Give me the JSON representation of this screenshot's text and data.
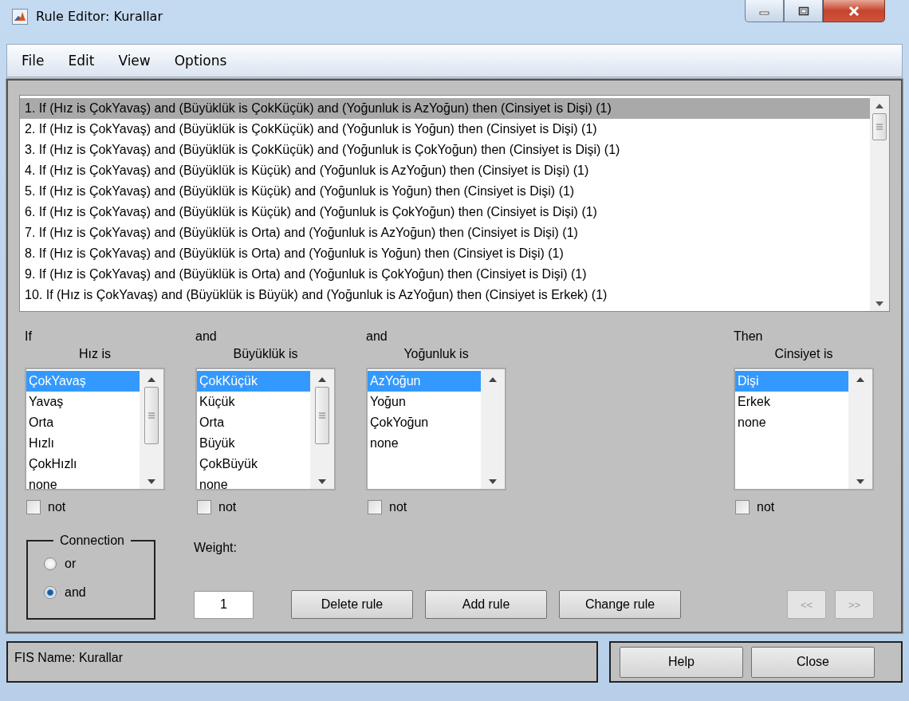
{
  "window": {
    "title": "Rule Editor: Kurallar"
  },
  "menu": [
    "File",
    "Edit",
    "View",
    "Options"
  ],
  "rules": [
    {
      "text": "1. If (Hız is ÇokYavaş) and (Büyüklük is ÇokKüçük) and (Yoğunluk is AzYoğun) then (Cinsiyet is Dişi) (1)",
      "selected": true
    },
    {
      "text": "2. If (Hız is ÇokYavaş) and (Büyüklük is ÇokKüçük) and (Yoğunluk is Yoğun) then (Cinsiyet is Dişi) (1)",
      "selected": false
    },
    {
      "text": "3. If (Hız is ÇokYavaş) and (Büyüklük is ÇokKüçük) and (Yoğunluk is ÇokYoğun) then (Cinsiyet is Dişi) (1)",
      "selected": false
    },
    {
      "text": "4. If (Hız is ÇokYavaş) and (Büyüklük is Küçük) and (Yoğunluk is AzYoğun) then (Cinsiyet is Dişi) (1)",
      "selected": false
    },
    {
      "text": "5. If (Hız is ÇokYavaş) and (Büyüklük is Küçük) and (Yoğunluk is Yoğun) then (Cinsiyet is Dişi) (1)",
      "selected": false
    },
    {
      "text": "6. If (Hız is ÇokYavaş) and (Büyüklük is Küçük) and (Yoğunluk is ÇokYoğun) then (Cinsiyet is Dişi) (1)",
      "selected": false
    },
    {
      "text": "7. If (Hız is ÇokYavaş) and (Büyüklük is Orta) and (Yoğunluk is AzYoğun) then (Cinsiyet is Dişi) (1)",
      "selected": false
    },
    {
      "text": "8. If (Hız is ÇokYavaş) and (Büyüklük is Orta) and (Yoğunluk is Yoğun) then (Cinsiyet is Dişi) (1)",
      "selected": false
    },
    {
      "text": "9. If (Hız is ÇokYavaş) and (Büyüklük is Orta) and (Yoğunluk is ÇokYoğun) then (Cinsiyet is Dişi) (1)",
      "selected": false
    },
    {
      "text": "10. If (Hız is ÇokYavaş) and (Büyüklük is Büyük) and (Yoğunluk is AzYoğun) then (Cinsiyet is Erkek) (1)",
      "selected": false
    }
  ],
  "columns": [
    {
      "connector": "If",
      "label": "Hız is",
      "scrollable": true,
      "not": false,
      "options": [
        {
          "label": "ÇokYavaş",
          "selected": true
        },
        {
          "label": "Yavaş",
          "selected": false
        },
        {
          "label": "Orta",
          "selected": false
        },
        {
          "label": "Hızlı",
          "selected": false
        },
        {
          "label": "ÇokHızlı",
          "selected": false
        },
        {
          "label": "none",
          "selected": false
        }
      ]
    },
    {
      "connector": "and",
      "label": "Büyüklük is",
      "scrollable": true,
      "not": false,
      "options": [
        {
          "label": "ÇokKüçük",
          "selected": true
        },
        {
          "label": "Küçük",
          "selected": false
        },
        {
          "label": "Orta",
          "selected": false
        },
        {
          "label": "Büyük",
          "selected": false
        },
        {
          "label": "ÇokBüyük",
          "selected": false
        },
        {
          "label": "none",
          "selected": false
        }
      ]
    },
    {
      "connector": "and",
      "label": "Yoğunluk is",
      "scrollable": false,
      "not": false,
      "options": [
        {
          "label": "AzYoğun",
          "selected": true
        },
        {
          "label": "Yoğun",
          "selected": false
        },
        {
          "label": "ÇokYoğun",
          "selected": false
        },
        {
          "label": "none",
          "selected": false
        }
      ]
    },
    {
      "connector": "Then",
      "label": "Cinsiyet is",
      "scrollable": false,
      "not": false,
      "options": [
        {
          "label": "Dişi",
          "selected": true
        },
        {
          "label": "Erkek",
          "selected": false
        },
        {
          "label": "none",
          "selected": false
        }
      ]
    }
  ],
  "not_labels": [
    "not",
    "not",
    "not",
    "not"
  ],
  "connection": {
    "title": "Connection",
    "options": [
      {
        "label": "or",
        "selected": false
      },
      {
        "label": "and",
        "selected": true
      }
    ]
  },
  "weight": {
    "label": "Weight:",
    "value": "1"
  },
  "buttons": [
    "Delete rule",
    "Add rule",
    "Change rule"
  ],
  "nav_buttons": [
    {
      "label": "<<",
      "disabled": true
    },
    {
      "label": ">>",
      "disabled": true
    }
  ],
  "status": "FIS Name: Kurallar",
  "footer_buttons": [
    "Help",
    "Close"
  ]
}
